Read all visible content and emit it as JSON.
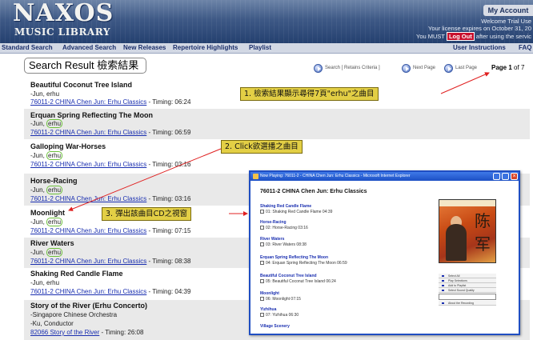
{
  "header": {
    "logo": "NAXOS",
    "logo_sub": "MUSIC LIBRARY",
    "account_tab": "My Account",
    "welcome": "Welcome Trial Use",
    "license": "Your license expires on October 31, 20",
    "must_prefix": "You MUST",
    "logout": "Log Out",
    "must_suffix": "after using the servic"
  },
  "nav": {
    "items": [
      "Standard Search",
      "Advanced Search",
      "New Releases",
      "Repertoire Highlights",
      "Playlist"
    ],
    "user_instructions": "User Instructions",
    "faq": "FAQ"
  },
  "search": {
    "title": "Search Result 檢索結果",
    "retains": "Search [ Retains Criteria ]",
    "next": "Next Page",
    "last": "Last Page",
    "page_label": "Page",
    "page_num": "1",
    "page_of": "of 7"
  },
  "results": [
    {
      "title": "Beautiful Coconut Tree Island",
      "artist_a": "-Jun, erhu",
      "artist_b": "",
      "link": "76011-2 CHINA Chen Jun: Erhu Classics",
      "timing": " - Timing: 06:24"
    },
    {
      "title": "Erquan Spring Reflecting The Moon",
      "artist_a": "-Jun, ",
      "artist_b": "erhu",
      "link": "76011-2 CHINA Chen Jun: Erhu Classics",
      "timing": " - Timing: 06:59"
    },
    {
      "title": "Galloping War-Horses",
      "artist_a": "-Jun, ",
      "artist_b": "erhu",
      "link": "76011-2 CHINA Chen Jun: Erhu Classics",
      "timing": " - Timing: 03:16"
    },
    {
      "title": "Horse-Racing",
      "artist_a": "-Jun, ",
      "artist_b": "erhu",
      "link": "76011-2 CHINA Chen Jun: Erhu Classics",
      "timing": " - Timing: 03:16"
    },
    {
      "title": "Moonlight",
      "artist_a": "-Jun, ",
      "artist_b": "erhu",
      "link": "76011-2 CHINA Chen Jun: Erhu Classics",
      "timing": " - Timing: 07:15"
    },
    {
      "title": "River Waters",
      "artist_a": "-Jun, ",
      "artist_b": "erhu",
      "link": "76011-2 CHINA Chen Jun: Erhu Classics",
      "timing": " - Timing: 08:38"
    },
    {
      "title": "Shaking Red Candle Flame",
      "artist_a": "-Jun, erhu",
      "artist_b": "",
      "link": "76011-2 CHINA Chen Jun: Erhu Classics",
      "timing": " - Timing: 04:39"
    }
  ],
  "last_result": {
    "title": "Story of the River (Erhu Concerto)",
    "line1": "-Singapore Chinese Orchestra",
    "line2": "-Ku, Conductor",
    "link": "82066 Story of the River",
    "timing": " - Timing: 26:08"
  },
  "annotations": {
    "a1": "1. 檢索結果顯示尋得7頁\"erhu\"之曲目",
    "a2": "2. Click欲選播之曲目",
    "a3": "3. 彈出該曲目CD之視窗"
  },
  "popup": {
    "titlebar": "Now Playing: 76011-2 - CHINA Chen Jun: Erhu Classics - Microsoft Internet Explorer",
    "album": "76011-2 CHINA Chen Jun: Erhu Classics",
    "tracks": [
      {
        "title": "Shaking Red Candle Flame",
        "line": "01: Shaking Red Candle Flame 04:39"
      },
      {
        "title": "Horse-Racing",
        "line": "02: Horse-Racing 03:16"
      },
      {
        "title": "River Waters",
        "line": "03: River Waters 08:38"
      },
      {
        "title": "Erquan Spring Reflecting The Moon",
        "line": "04: Erquan Spring Reflecting The Moon 06:59"
      },
      {
        "title": "Beautiful Coconut Tree Island",
        "line": "05: Beautiful Coconut Tree Island 06:24"
      },
      {
        "title": "Moonlight",
        "line": "06: Moonlight 07:15"
      },
      {
        "title": "Yizhihua",
        "line": "07: Yizhihua 06:30"
      },
      {
        "title": "Village Scenery",
        "line": ""
      }
    ],
    "menu": [
      "Select All",
      "Play Selections",
      "Add to Playlist",
      "Select Sound Quality",
      "About the Recording"
    ],
    "cover_script": "陈军"
  },
  "colors": {
    "header_dark": "#24406f",
    "callout": "#e3cf45",
    "link": "#1a2fb0",
    "arrow": "#e02020",
    "logout": "#c8102e"
  }
}
